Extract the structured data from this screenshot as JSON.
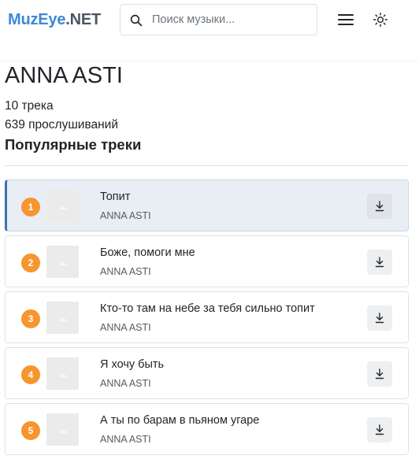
{
  "header": {
    "brand_part1": "MuzEye",
    "brand_part2": ".NET",
    "search_placeholder": "Поиск музыки...",
    "icons": [
      "search-icon",
      "hamburger-menu-icon",
      "sun-icon"
    ]
  },
  "artist": {
    "name": "ANNA ASTI",
    "tracks_count": "10 трека",
    "listens": "639 прослушиваний"
  },
  "section_title": "Популярные треки",
  "colors": {
    "brand_blue": "#3a8ad8",
    "rank_badge": "#f7952f",
    "active_accent": "#3d72b4",
    "active_bg": "#e9eef5"
  },
  "tracks": [
    {
      "rank": "1",
      "title": "Топит",
      "artist": "ANNA ASTI",
      "active": true
    },
    {
      "rank": "2",
      "title": "Боже, помоги мне",
      "artist": "ANNA ASTI",
      "active": false
    },
    {
      "rank": "3",
      "title": "Кто-то там на небе за тебя сильно топит",
      "artist": "ANNA ASTI",
      "active": false
    },
    {
      "rank": "4",
      "title": "Я хочу быть",
      "artist": "ANNA ASTI",
      "active": false
    },
    {
      "rank": "5",
      "title": "А ты по барам в пьяном угаре",
      "artist": "ANNA ASTI",
      "active": false
    }
  ]
}
